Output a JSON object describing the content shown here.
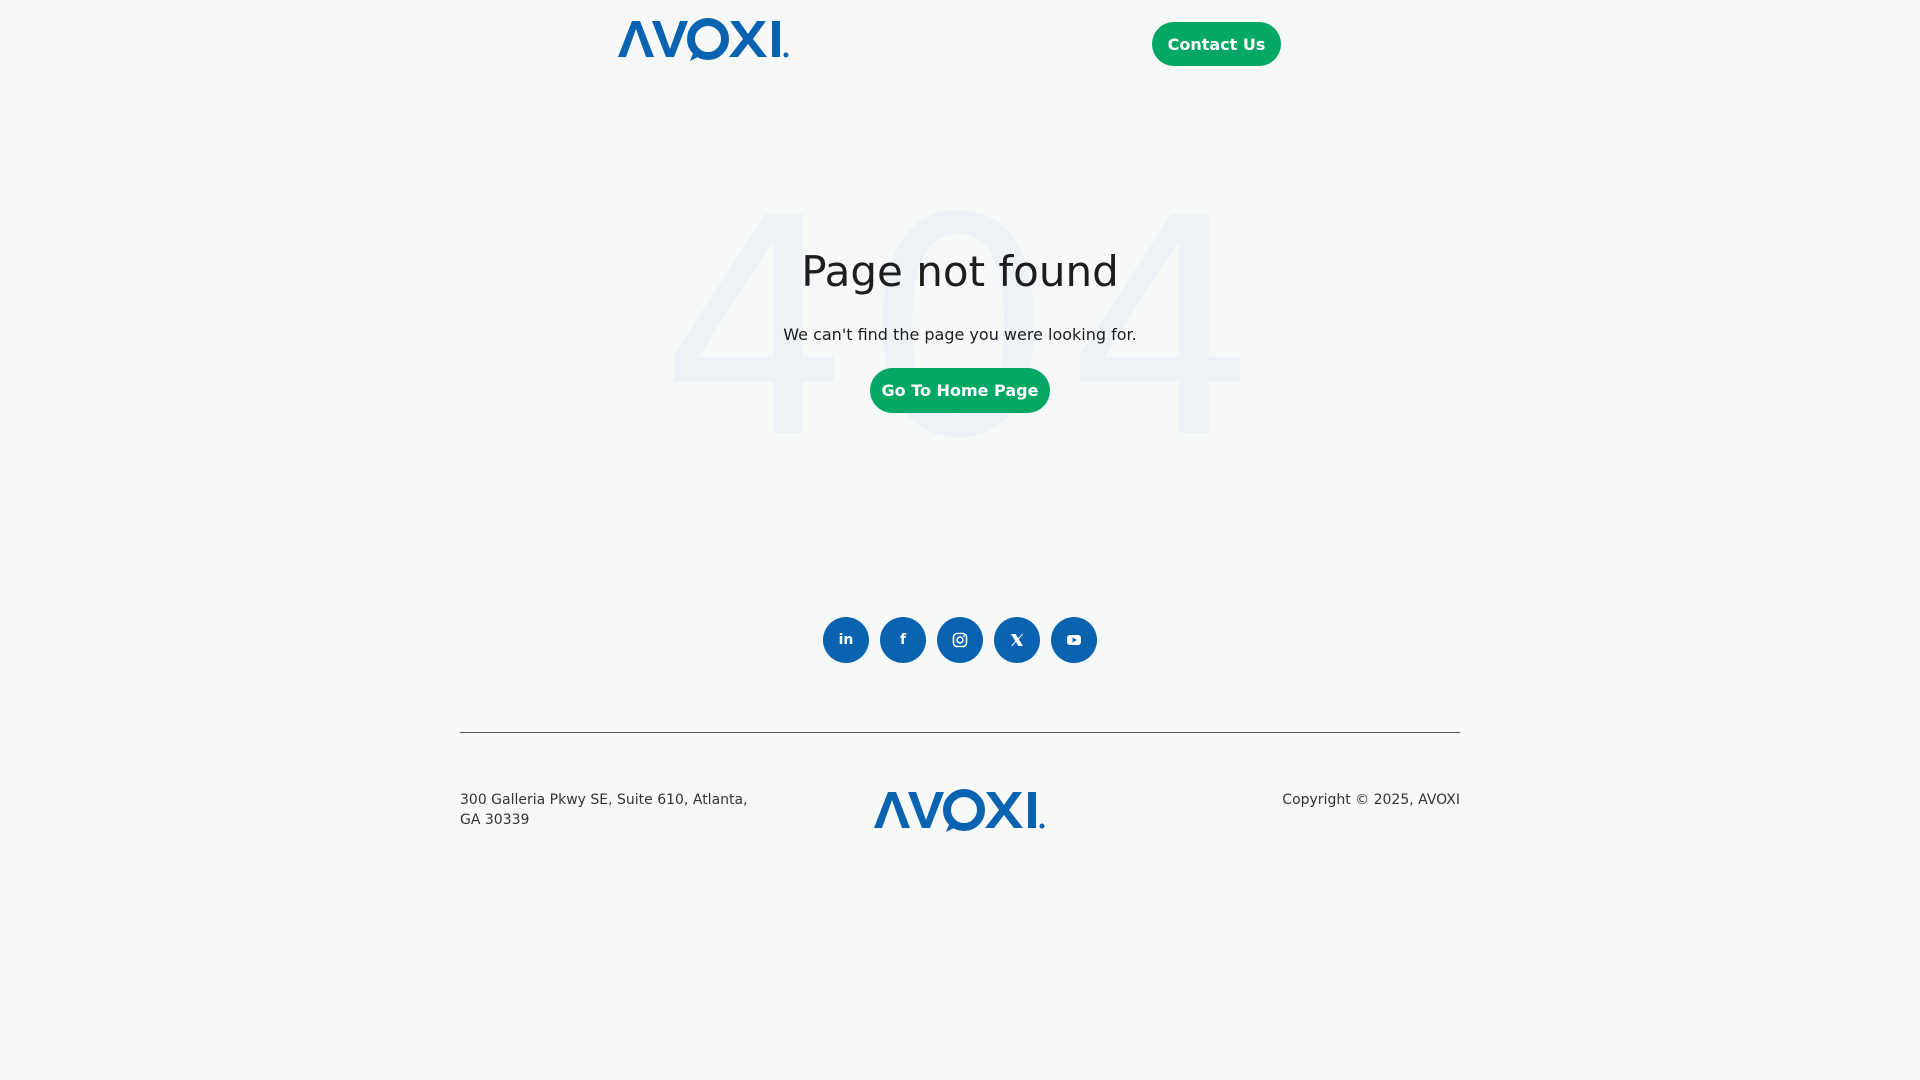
{
  "header": {
    "logo_text": "AVOXI",
    "contact_label": "Contact Us"
  },
  "hero": {
    "bg_text": "404",
    "title": "Page not found",
    "subtitle": "We can't find the page you were looking for.",
    "home_button_label": "Go To Home Page"
  },
  "social": {
    "items": [
      {
        "name": "linkedin-icon",
        "label": "in"
      },
      {
        "name": "facebook-icon",
        "label": "f"
      },
      {
        "name": "instagram-icon",
        "label": ""
      },
      {
        "name": "x-twitter-icon",
        "label": ""
      },
      {
        "name": "youtube-icon",
        "label": ""
      }
    ],
    "bg_color": "#0a63b0"
  },
  "footer": {
    "address": "300 Galleria Pkwy SE, Suite 610, Atlanta, GA 30339",
    "logo_text": "AVOXI",
    "copyright": "Copyright © 2025, AVOXI"
  },
  "colors": {
    "brand_blue": "#0a63b0",
    "brand_green": "#03a865",
    "background": "#f7f9f9"
  }
}
